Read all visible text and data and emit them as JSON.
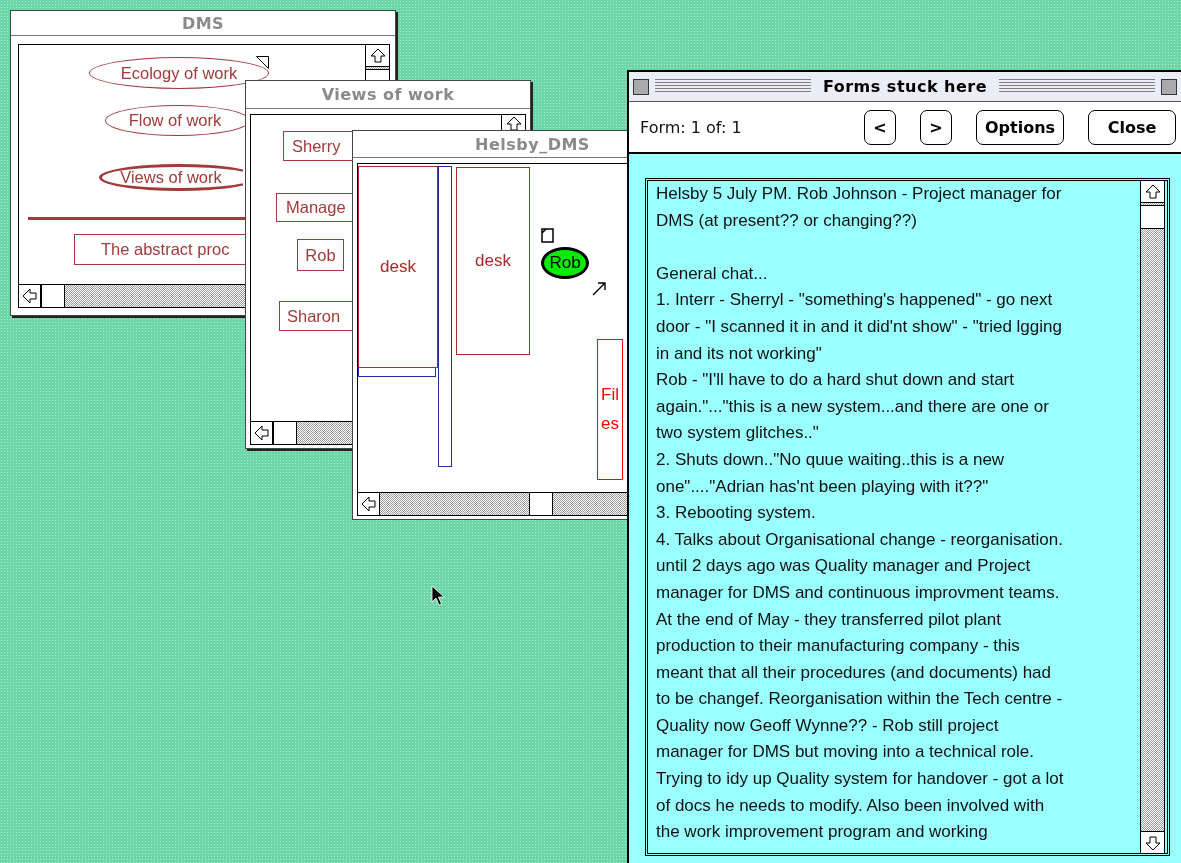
{
  "desktop": {
    "windows": [
      {
        "title": "DMS",
        "active": false,
        "items": [
          {
            "kind": "oval",
            "label": "Ecology of work"
          },
          {
            "kind": "oval",
            "label": "Flow of work"
          },
          {
            "kind": "oval-bold",
            "label": "Views of work"
          },
          {
            "kind": "box",
            "label": "The abstract proc"
          }
        ]
      },
      {
        "title": "Views of work",
        "active": false,
        "items": [
          {
            "kind": "box",
            "label": "Sherry"
          },
          {
            "kind": "box",
            "label": "Manage"
          },
          {
            "kind": "box",
            "label": "Rob"
          },
          {
            "kind": "box",
            "label": "Sharon"
          }
        ]
      },
      {
        "title": "Helsby_DMS",
        "active": false,
        "items": [
          {
            "kind": "box",
            "label": "desk",
            "color": "#a52a2a"
          },
          {
            "kind": "box",
            "label": "desk",
            "color": "#a52a2a"
          },
          {
            "kind": "oval-filled",
            "label": "Rob",
            "color": "#00ee00"
          },
          {
            "kind": "box",
            "label": "Files",
            "color": "#ff0000"
          }
        ]
      }
    ]
  },
  "forms_window": {
    "title": "Forms stuck here",
    "active": true,
    "form_counter": "Form: 1 of: 1",
    "buttons": [
      "<",
      ">",
      "Options",
      "Close"
    ],
    "paragraphs": [
      [
        "Helsby 5 July PM. Rob Johnson - Project manager for",
        "DMS (at present?? or changing??)"
      ],
      [
        "General chat...",
        "1. Interr - Sherryl - \"something's happened\" - go next",
        "door - \"I scanned it in and it did'nt show\" - \"tried lgging",
        "in and its not working\"",
        "Rob - \"I'll have to do a hard shut down and start",
        "again.\"...\"this is a new system...and there are one or",
        "two system glitches..\"",
        "2. Shuts down..\"No quue waiting..this is a new",
        "one\"....\"Adrian has'nt been playing with it??\"",
        "3. Rebooting system.",
        "4. Talks about Organisational change - reorganisation.",
        "until 2 days ago was Quality manager and Project",
        "manager for DMS and continuous improvment teams.",
        "At the end of May - they transferred pilot plant",
        "production to their manufacturing company - this",
        "meant that all their procedures (and documents) had",
        "to be changef. Reorganisation within the Tech centre -",
        "Quality now  Geoff Wynne?? - Rob still project",
        "manager for DMS but moving into a technical role.",
        "Trying to idy up Quality system for handover - got a lot",
        "of docs he needs to modify. Also been involved with",
        "the work improvement program and working"
      ]
    ]
  }
}
